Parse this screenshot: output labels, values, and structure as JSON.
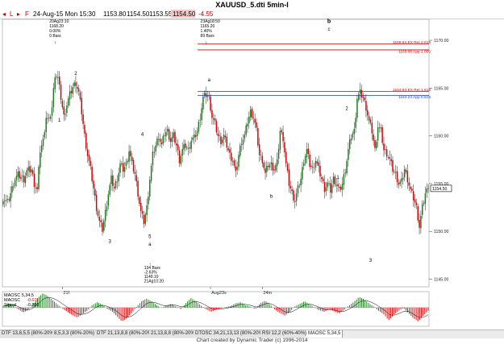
{
  "window": {
    "title": "XAUUSD_5.dti 5min-I"
  },
  "toolbar": {
    "icons": [
      "left-nav-icon",
      "right-nav-icon"
    ],
    "left_label": "L",
    "f_label": "F",
    "date_time": "24-Aug-15 Mon 15:30",
    "open": "1153.80",
    "high": "1154.50",
    "low": "1153.55",
    "close": "1154.50",
    "change": "-4.55",
    "close_highlight_color": "#f4c7c7"
  },
  "chart_data": [
    {
      "type": "candlestick",
      "symbol": "XAUUSD",
      "timeframe": "5min",
      "x_tick_labels": [
        "21f",
        "Aug23s",
        "24m"
      ],
      "ylim": [
        1144.2,
        1172.2
      ],
      "y_ticks": [
        1145.0,
        1150.0,
        1155.0,
        1160.0,
        1165.0,
        1170.0
      ],
      "y_tick_labels": [
        "1145.00",
        "1150.00",
        "1155.00",
        "1160.00",
        "1165.00",
        "1170.00"
      ],
      "current_price_label": "1154.50",
      "grid": false,
      "up_color": "#1a7a1a",
      "down_color": "#d40000",
      "anchors": [
        [
          0,
          1153.5
        ],
        [
          3,
          1153.0
        ],
        [
          5,
          1154.0
        ],
        [
          8,
          1155.5
        ],
        [
          10,
          1155.9
        ],
        [
          14,
          1155.5
        ],
        [
          16,
          1156.3
        ],
        [
          19,
          1156.5
        ],
        [
          21,
          1155.0
        ],
        [
          23,
          1154.3
        ],
        [
          25,
          1158.5
        ],
        [
          27,
          1159.5
        ],
        [
          29,
          1162.0
        ],
        [
          31,
          1161.5
        ],
        [
          33,
          1163.0
        ],
        [
          35,
          1166.5
        ],
        [
          37,
          1166.0
        ],
        [
          39,
          1164.0
        ],
        [
          41,
          1162.0
        ],
        [
          43,
          1163.3
        ],
        [
          45,
          1164.3
        ],
        [
          47,
          1165.1
        ],
        [
          49,
          1165.6
        ],
        [
          51,
          1164.5
        ],
        [
          53,
          1162.5
        ],
        [
          55,
          1160.0
        ],
        [
          57,
          1158.0
        ],
        [
          59,
          1156.5
        ],
        [
          61,
          1154.5
        ],
        [
          63,
          1152.5
        ],
        [
          65,
          1151.0
        ],
        [
          67,
          1150.2
        ],
        [
          69,
          1152.0
        ],
        [
          71,
          1154.0
        ],
        [
          73,
          1155.5
        ],
        [
          75,
          1154.5
        ],
        [
          77,
          1155.5
        ],
        [
          79,
          1157.0
        ],
        [
          81,
          1156.5
        ],
        [
          83,
          1157.0
        ],
        [
          85,
          1158.5
        ],
        [
          87,
          1157.0
        ],
        [
          89,
          1156.0
        ],
        [
          91,
          1154.0
        ],
        [
          93,
          1152.0
        ],
        [
          95,
          1151.0
        ],
        [
          97,
          1152.5
        ],
        [
          99,
          1155.5
        ],
        [
          101,
          1158.0
        ],
        [
          103,
          1159.0
        ],
        [
          105,
          1160.0
        ],
        [
          107,
          1159.0
        ],
        [
          109,
          1160.3
        ],
        [
          111,
          1160.5
        ],
        [
          113,
          1159.5
        ],
        [
          115,
          1160.0
        ],
        [
          117,
          1159.0
        ],
        [
          119,
          1157.5
        ],
        [
          121,
          1158.5
        ],
        [
          123,
          1159.0
        ],
        [
          125,
          1158.5
        ],
        [
          127,
          1159.6
        ],
        [
          129,
          1159.8
        ],
        [
          131,
          1160.5
        ],
        [
          133,
          1162.0
        ],
        [
          135,
          1164.0
        ],
        [
          137,
          1164.3
        ],
        [
          139,
          1164.0
        ],
        [
          141,
          1162.0
        ],
        [
          143,
          1161.2
        ],
        [
          145,
          1160.0
        ],
        [
          147,
          1159.5
        ],
        [
          149,
          1160.0
        ],
        [
          151,
          1159.0
        ],
        [
          153,
          1158.0
        ],
        [
          155,
          1157.5
        ],
        [
          157,
          1156.0
        ],
        [
          159,
          1158.0
        ],
        [
          161,
          1159.5
        ],
        [
          163,
          1160.0
        ],
        [
          165,
          1161.5
        ],
        [
          167,
          1162.5
        ],
        [
          169,
          1162.0
        ],
        [
          171,
          1160.5
        ],
        [
          173,
          1158.0
        ],
        [
          175,
          1157.5
        ],
        [
          177,
          1156.0
        ],
        [
          179,
          1157.0
        ],
        [
          181,
          1157.0
        ],
        [
          183,
          1156.5
        ],
        [
          185,
          1157.2
        ],
        [
          187,
          1160.5
        ],
        [
          189,
          1159.8
        ],
        [
          191,
          1157.0
        ],
        [
          193,
          1155.0
        ],
        [
          195,
          1154.0
        ],
        [
          197,
          1153.2
        ],
        [
          199,
          1154.5
        ],
        [
          201,
          1155.5
        ],
        [
          203,
          1157.5
        ],
        [
          205,
          1158.5
        ],
        [
          207,
          1157.0
        ],
        [
          209,
          1156.5
        ],
        [
          211,
          1157.5
        ],
        [
          213,
          1156.5
        ],
        [
          215,
          1155.5
        ],
        [
          217,
          1154.5
        ],
        [
          219,
          1155.0
        ],
        [
          221,
          1154.3
        ],
        [
          223,
          1155.5
        ],
        [
          225,
          1155.0
        ],
        [
          227,
          1154.2
        ],
        [
          229,
          1155.0
        ],
        [
          231,
          1156.5
        ],
        [
          233,
          1158.5
        ],
        [
          235,
          1160.0
        ],
        [
          237,
          1160.5
        ],
        [
          239,
          1164.0
        ],
        [
          241,
          1164.5
        ],
        [
          243,
          1164.0
        ],
        [
          245,
          1163.0
        ],
        [
          247,
          1161.5
        ],
        [
          249,
          1160.5
        ],
        [
          251,
          1158.5
        ],
        [
          253,
          1161.0
        ],
        [
          255,
          1160.5
        ],
        [
          257,
          1158.5
        ],
        [
          259,
          1158.2
        ],
        [
          261,
          1157.5
        ],
        [
          263,
          1156.5
        ],
        [
          265,
          1156.0
        ],
        [
          267,
          1155.0
        ],
        [
          269,
          1155.2
        ],
        [
          271,
          1156.5
        ],
        [
          273,
          1155.5
        ],
        [
          275,
          1154.3
        ],
        [
          277,
          1153.5
        ],
        [
          279,
          1152.5
        ],
        [
          281,
          1150.5
        ],
        [
          283,
          1152.5
        ],
        [
          285,
          1154.0
        ],
        [
          287,
          1154.5
        ]
      ],
      "hlines": [
        {
          "price": 1169.64,
          "label": "1169.64 EX Ret 2.618",
          "color": "#d40000"
        },
        {
          "price": 1169.0,
          "label": "1169.00 App 1.000",
          "color": "#d40000"
        },
        {
          "price": 1164.64,
          "label": "1164.64 EX Ret 1.618",
          "color": "#d40000"
        },
        {
          "price": 1164.24,
          "label": "1164.24 App 0.618",
          "color": "#1f3fd0"
        }
      ],
      "price_annotations": [
        {
          "index": 35,
          "anchor": "above",
          "lines": [
            "20Ag23:10",
            "1168.20",
            "0.00%",
            "0 Bars"
          ]
        },
        {
          "index": 137,
          "anchor": "above",
          "lines": [
            "23Ag18:50",
            "1165.20",
            "1.40%",
            "89 Bars"
          ]
        },
        {
          "index": 99,
          "anchor": "below",
          "lines": [
            "134 Bars",
            "-2.63%",
            "1149.10",
            "21Ag10:20"
          ]
        }
      ],
      "wave_labels": [
        {
          "text": "1",
          "index": 38,
          "price": 1161.5,
          "bold": false
        },
        {
          "text": "2",
          "index": 49,
          "price": 1166.4,
          "bold": false
        },
        {
          "text": "3",
          "index": 72,
          "price": 1148.8,
          "bold": false
        },
        {
          "text": "4",
          "index": 94,
          "price": 1160.0,
          "bold": false
        },
        {
          "text": "5",
          "index": 99,
          "price": 1149.3,
          "bold": false
        },
        {
          "text": "a",
          "index": 99,
          "price": 1148.5,
          "bold": false
        },
        {
          "text": "a",
          "index": 139,
          "price": 1165.7,
          "bold": false
        },
        {
          "text": "b",
          "index": 181,
          "price": 1153.5,
          "bold": false
        },
        {
          "text": "b",
          "index": 220,
          "price": 1171.8,
          "bold": true
        },
        {
          "text": "c",
          "index": 220,
          "price": 1171.0,
          "bold": false
        },
        {
          "text": "1",
          "index": 226,
          "price": 1155.5,
          "bold": false
        },
        {
          "text": "2",
          "index": 232,
          "price": 1162.7,
          "bold": false
        },
        {
          "text": "3",
          "index": 248,
          "price": 1146.8,
          "bold": false
        }
      ]
    },
    {
      "type": "bar",
      "title": "MAOSC 5,34,5",
      "series": [
        {
          "name": "MAOSC",
          "label_value": "-0.611",
          "color": "#d40000"
        },
        {
          "name": "Signal",
          "label_value": "-0.886",
          "color": "#000000"
        }
      ],
      "up_color": "#1a7a1a",
      "down_color": "#d40000",
      "ylim": [
        -3.5,
        3.0
      ],
      "values": [
        0.3,
        0.8,
        0.4,
        -0.3,
        -0.9,
        -0.5,
        0.6,
        1.8,
        2.7,
        2.2,
        1.4,
        0.6,
        -0.2,
        -0.8,
        -1.4,
        -1.9,
        -1.2,
        -0.6,
        0.5,
        1.0,
        0.6,
        -0.2,
        -0.7,
        -1.6,
        -2.6,
        -2.0,
        -1.0,
        0.2,
        1.2,
        1.7,
        1.2,
        0.5,
        -0.1,
        0.4,
        0.7,
        0.2,
        -0.3,
        0.9,
        1.8,
        1.2,
        0.4,
        -0.3,
        -0.8,
        -0.4,
        -0.2,
        0.1,
        0.3,
        0.8,
        1.0,
        0.4,
        0.2,
        -0.3,
        0.8,
        1.3,
        0.6,
        -0.4,
        -1.0,
        -1.5,
        -0.8,
        0.2,
        0.7,
        1.2,
        0.6,
        0.0,
        -0.5,
        -0.8,
        -0.3,
        -0.7,
        -1.1,
        -0.4,
        0.4,
        1.1,
        2.0,
        1.6,
        0.8,
        0.2,
        -0.6,
        -1.2,
        -2.4,
        -1.4,
        -0.6,
        -0.1,
        -1.0,
        -2.0,
        -2.6,
        -1.5,
        -0.6
      ]
    }
  ],
  "bottom_tabs": [
    {
      "label": "DTF 13,8,5,5 (80%-20%)",
      "active": false
    },
    {
      "label": "8,5,3,3 (80%-20%)",
      "active": false
    },
    {
      "label": "DTF 21,13,8,8 (80%-20%)",
      "active": false
    },
    {
      "label": "21,13,8,8 (80%-20%)",
      "active": false
    },
    {
      "label": "DTOSC 34,21,13,13 (80%-20%)",
      "active": false
    },
    {
      "label": "RSI 12,2 (60%-40%)",
      "active": false
    },
    {
      "label": "MAOSC 5,34,5",
      "active": true
    }
  ],
  "footer": {
    "credit": "Chart created by Dynamic Trader  (c)  1996-2014"
  }
}
